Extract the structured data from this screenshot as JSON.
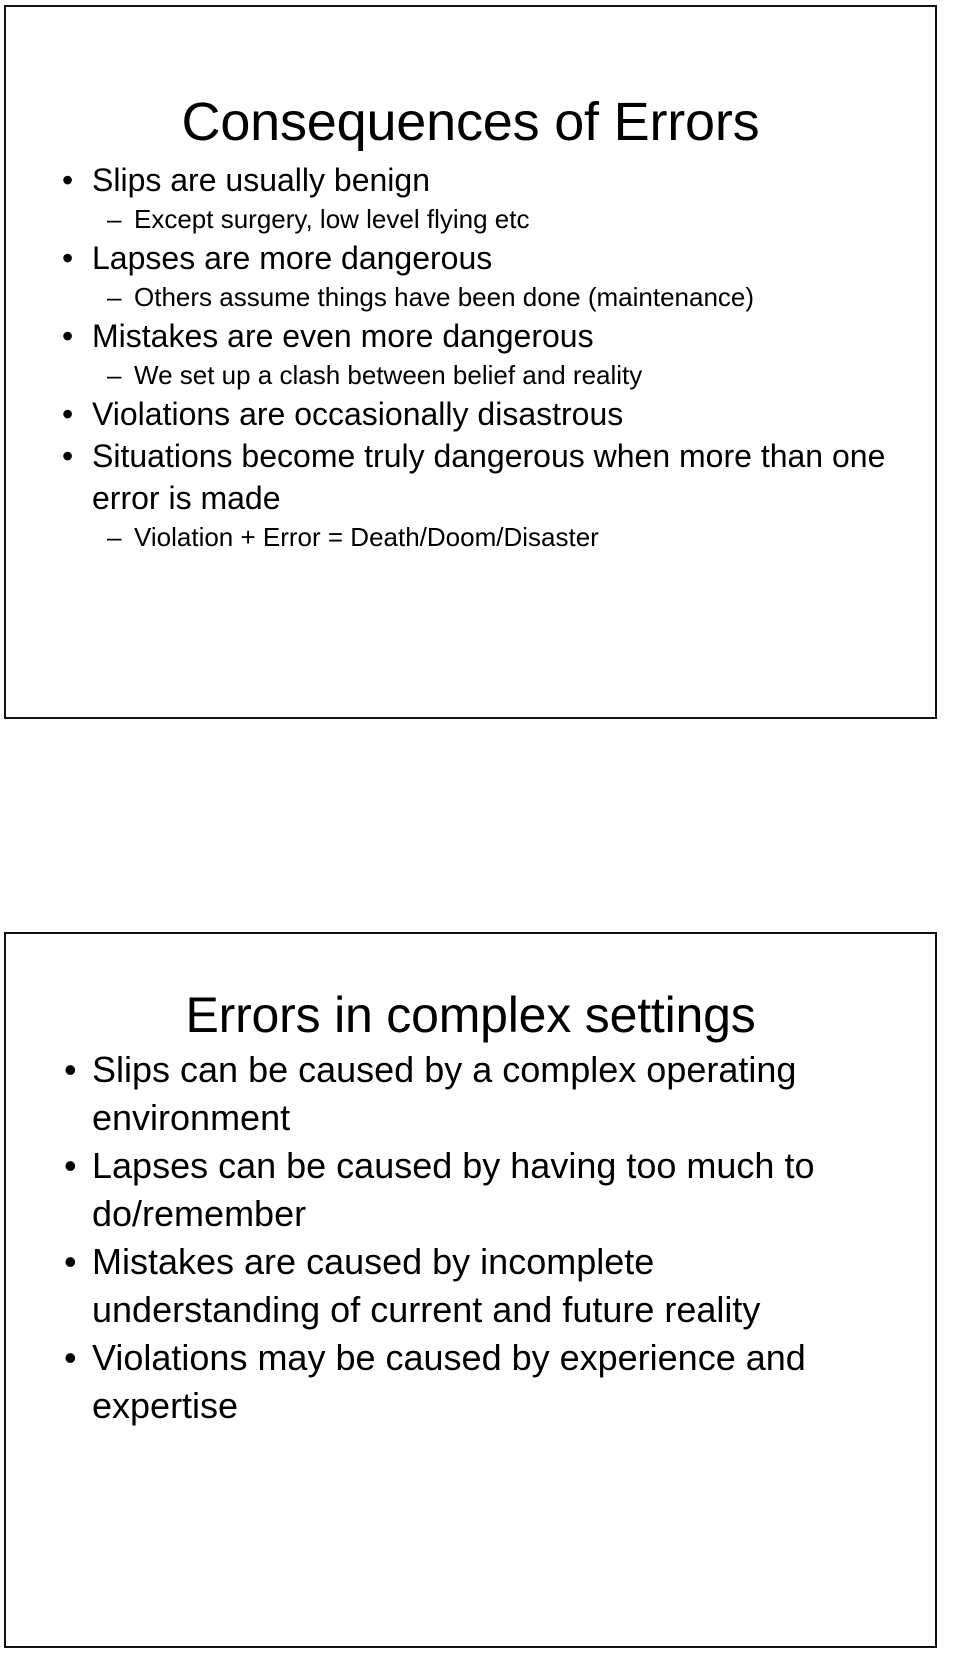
{
  "document": {
    "type": "presentation-handout",
    "slide_count": 2,
    "background_color": "#ffffff",
    "text_color": "#000000",
    "border_color": "#111111"
  },
  "slides": [
    {
      "title": "Consequences of Errors",
      "bullets": [
        {
          "level": 1,
          "marker": "•",
          "text": "Slips are usually benign"
        },
        {
          "level": 2,
          "marker": "–",
          "text": "Except surgery, low level flying etc"
        },
        {
          "level": 1,
          "marker": "•",
          "text": "Lapses are more dangerous"
        },
        {
          "level": 2,
          "marker": "–",
          "text": "Others assume things have been done (maintenance)"
        },
        {
          "level": 1,
          "marker": "•",
          "text": "Mistakes are even more dangerous"
        },
        {
          "level": 2,
          "marker": "–",
          "text": "We set up a clash between belief and reality"
        },
        {
          "level": 1,
          "marker": "•",
          "text": "Violations are occasionally disastrous"
        },
        {
          "level": 1,
          "marker": "•",
          "text": "Situations become truly dangerous when more than one error is made"
        },
        {
          "level": 2,
          "marker": "–",
          "text": "Violation + Error = Death/Doom/Disaster"
        }
      ]
    },
    {
      "title": "Errors in complex settings",
      "bullets": [
        {
          "level": 1,
          "marker": "•",
          "text": "Slips can be caused by a complex operating environment"
        },
        {
          "level": 1,
          "marker": "•",
          "text": "Lapses can be caused by having too much to do/remember"
        },
        {
          "level": 1,
          "marker": "•",
          "text": "Mistakes are caused by incomplete understanding of current and future reality"
        },
        {
          "level": 1,
          "marker": "•",
          "text": "Violations may be caused by experience and expertise"
        }
      ]
    }
  ]
}
